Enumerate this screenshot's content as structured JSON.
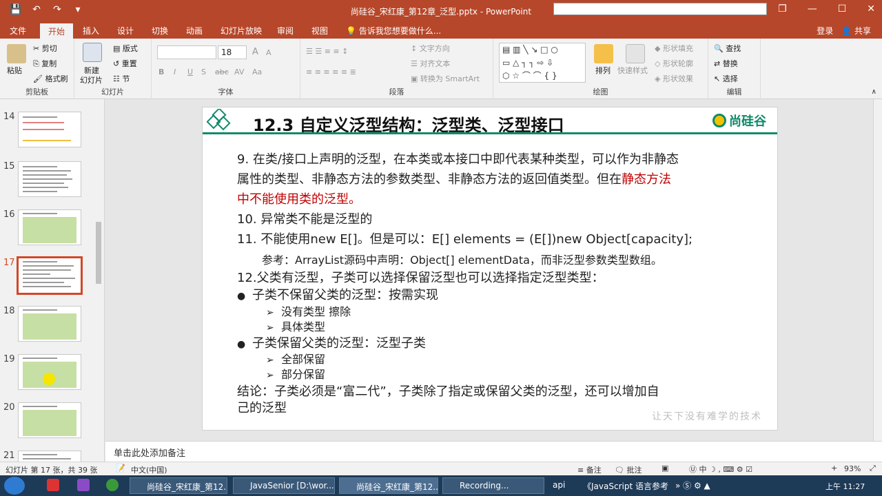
{
  "window": {
    "title": "尚硅谷_宋红康_第12章_泛型.pptx - PowerPoint",
    "qat_icons": [
      "save-icon",
      "undo-icon",
      "redo-icon",
      "customize-icon"
    ]
  },
  "tabs": [
    {
      "label": "文件"
    },
    {
      "label": "开始"
    },
    {
      "label": "插入"
    },
    {
      "label": "设计"
    },
    {
      "label": "切换"
    },
    {
      "label": "动画"
    },
    {
      "label": "幻灯片放映"
    },
    {
      "label": "审阅"
    },
    {
      "label": "视图"
    },
    {
      "label": "告诉我您想要做什么..."
    }
  ],
  "account": {
    "login": "登录",
    "share": "共享"
  },
  "ribbon": {
    "clipboard": {
      "paste": "粘贴",
      "cut": "剪切",
      "copy": "复制",
      "format_painter": "格式刷",
      "label": "剪贴板"
    },
    "slides": {
      "new_slide": "新建",
      "new_slide2": "幻灯片",
      "layout": "版式",
      "reset": "重置",
      "section": "节",
      "label": "幻灯片"
    },
    "font": {
      "size": "18",
      "label": "字体",
      "bold": "B",
      "italic": "I",
      "underline": "U",
      "shadow": "S",
      "strike": "abc",
      "spacing": "AV",
      "case": "Aa",
      "grow": "A",
      "shrink": "A"
    },
    "paragraph": {
      "text_direction": "文字方向",
      "align_text": "对齐文本",
      "smartart": "转换为 SmartArt",
      "label": "段落"
    },
    "drawing": {
      "arrange": "排列",
      "quick_styles": "快速样式",
      "fill": "形状填充",
      "outline": "形状轮廓",
      "effects": "形状效果",
      "label": "绘图"
    },
    "editing": {
      "find": "查找",
      "replace": "替换",
      "select": "选择",
      "label": "编辑"
    }
  },
  "thumbnails": [
    {
      "num": "14"
    },
    {
      "num": "15"
    },
    {
      "num": "16"
    },
    {
      "num": "17",
      "selected": true
    },
    {
      "num": "18"
    },
    {
      "num": "19"
    },
    {
      "num": "20"
    },
    {
      "num": "21"
    }
  ],
  "slide": {
    "title": "12.3 自定义泛型结构：泛型类、泛型接口",
    "logo_text": "尚硅谷",
    "watermark": "让天下没有难学的技术",
    "lines": {
      "l1": "9. 在类/接口上声明的泛型，在本类或本接口中即代表某种类型，可以作为非静态",
      "l2a": "属性的类型、非静态方法的参数类型、非静态方法的返回值类型。但在",
      "l2b": "静态方法",
      "l3": "中不能使用类的泛型。",
      "l4": "10. 异常类不能是泛型的",
      "l5": "11. 不能使用new E[]。但是可以：E[] elements = (E[])new Object[capacity];",
      "l6": "参考：ArrayList源码中声明：Object[] elementData，而非泛型参数类型数组。",
      "l7": "12.父类有泛型，子类可以选择保留泛型也可以选择指定泛型类型：",
      "l8": "子类不保留父类的泛型：按需实现",
      "l9": "没有类型  擦除",
      "l10": "具体类型",
      "l11": "子类保留父类的泛型：泛型子类",
      "l12": "全部保留",
      "l13": "部分保留",
      "l14": "结论：子类必须是“富二代”，子类除了指定或保留父类的泛型，还可以增加自",
      "l15": "己的泛型"
    }
  },
  "notes": {
    "placeholder": "单击此处添加备注"
  },
  "status": {
    "slide_info": "幻灯片 第 17 张，共 39 张",
    "language": "中文(中国)",
    "notes_btn": "备注",
    "comments_btn": "批注",
    "zoom": "93%"
  },
  "taskbar": {
    "items": [
      {
        "label": "尚硅谷_宋红康_第12..."
      },
      {
        "label": "JavaSenior [D:\\wor..."
      },
      {
        "label": "尚硅谷_宋红康_第12..."
      },
      {
        "label": "Recording..."
      }
    ],
    "tray_text": "api",
    "tray_tab": "《JavaScript 语言参考...",
    "clock": "上午 11:27"
  }
}
